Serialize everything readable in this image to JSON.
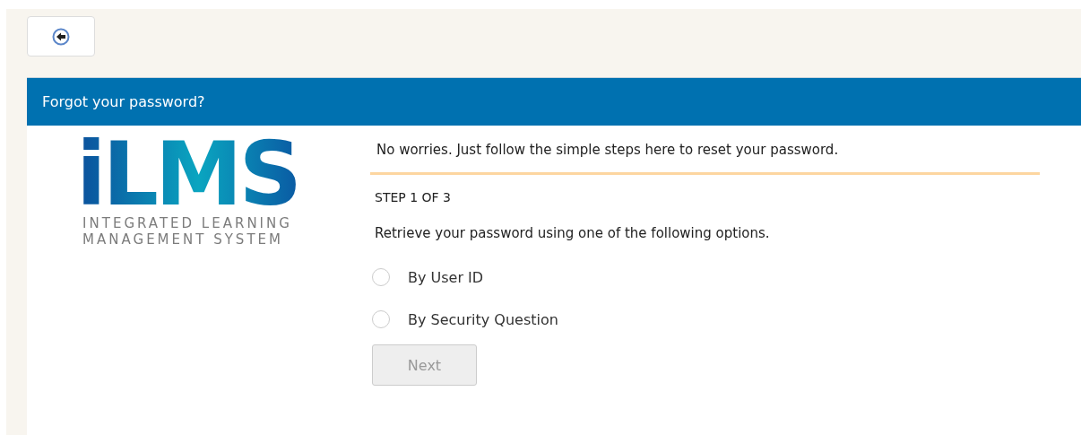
{
  "header": {
    "title": "Forgot your password?"
  },
  "logo": {
    "mark": "iLMS",
    "tagline_lines": [
      "INTEGRATED LEARNING",
      "MANAGEMENT SYSTEM"
    ]
  },
  "intro": "No worries. Just follow the simple steps here to reset your password.",
  "step": "STEP 1 OF 3",
  "instruction": "Retrieve your password using one of the following options.",
  "options": [
    {
      "label": "By User ID",
      "selected": false
    },
    {
      "label": "By Security Question",
      "selected": false
    }
  ],
  "next_button": {
    "label": "Next",
    "disabled": true
  }
}
